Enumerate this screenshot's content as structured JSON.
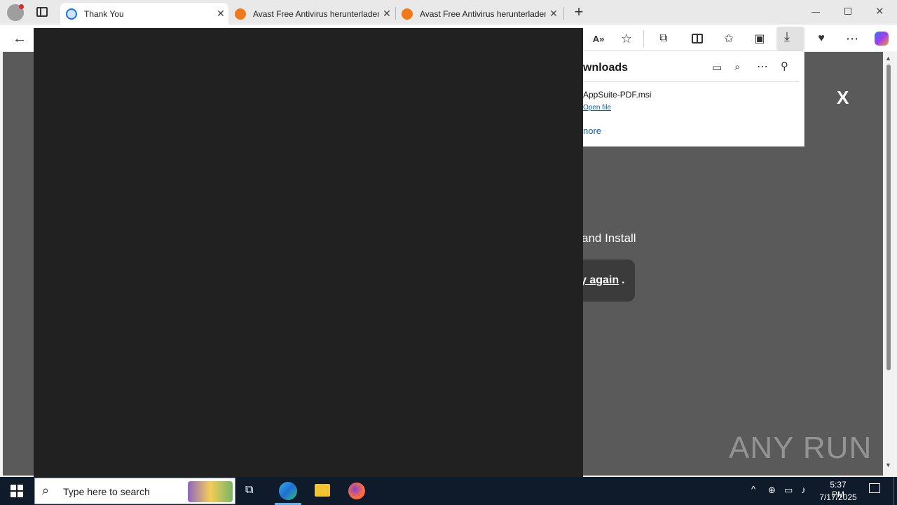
{
  "browser": {
    "tabs": [
      {
        "title": "Thank You"
      },
      {
        "title": "Avast Free Antivirus herunterladen"
      },
      {
        "title": "Avast Free Antivirus herunterladen"
      }
    ],
    "new_tab_symbol": "+"
  },
  "downloads": {
    "title_partial": "wnloads",
    "file_partial": "AppSuite-PDF.msi",
    "open_file": "Open file",
    "more_partial": "nore"
  },
  "page": {
    "close_x": "X",
    "text_partial": "and Install",
    "link_partial": "y again",
    "period": ".",
    "watermark": "ANY RUN"
  },
  "taskbar": {
    "search_placeholder": "Type here to search",
    "time": "5:37 PM",
    "date": "7/17/2025"
  },
  "colors": {
    "accent": "#0f5db8",
    "taskbar": "#0f1a2b",
    "overlay": "#212121"
  }
}
